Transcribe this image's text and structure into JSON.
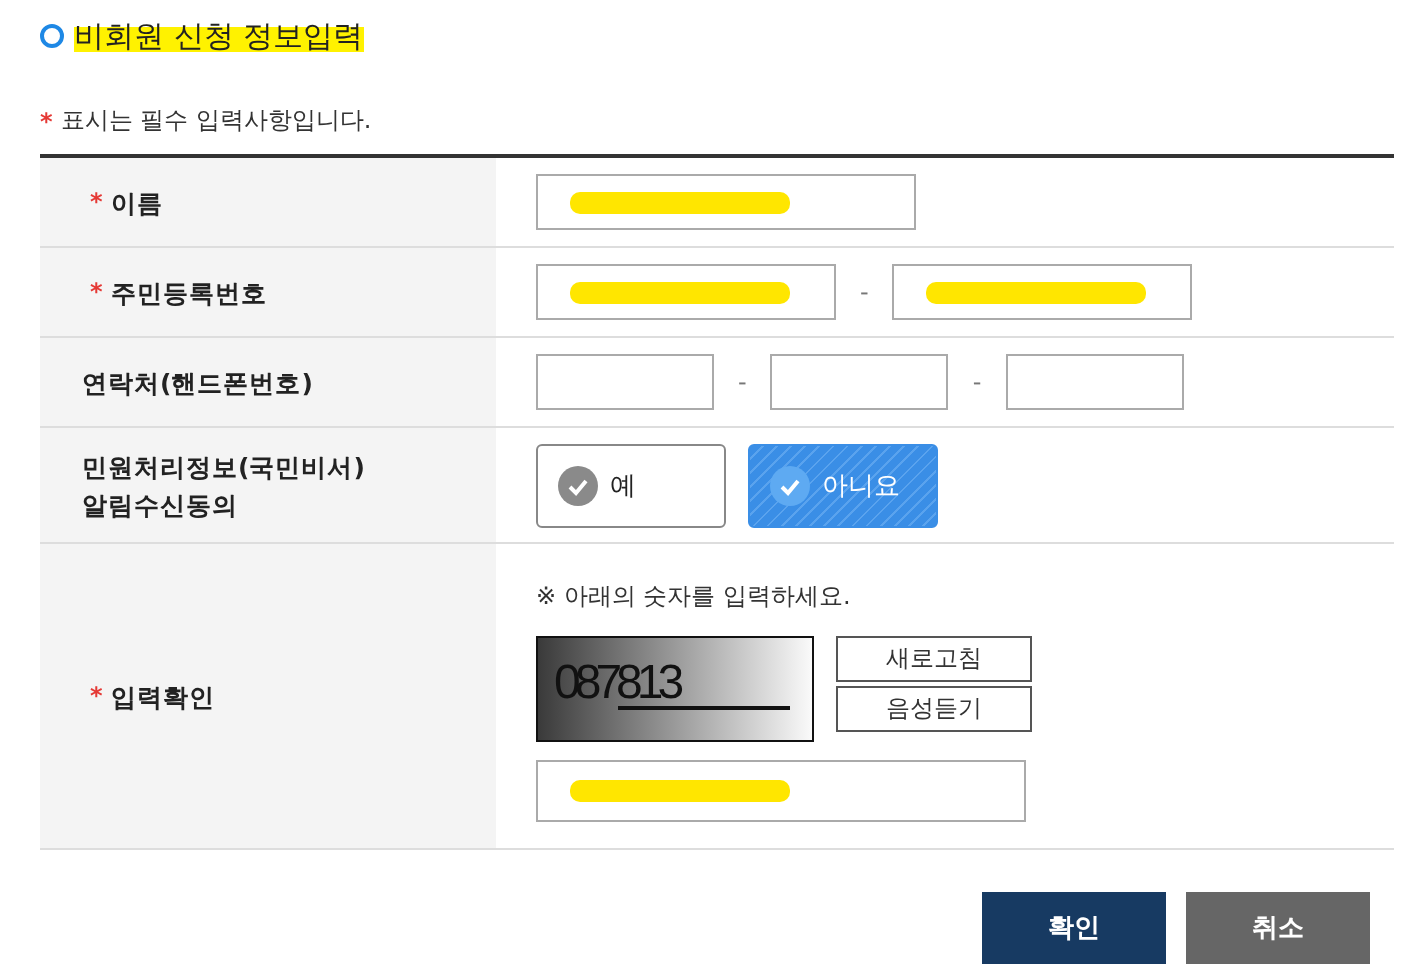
{
  "title": {
    "text": "비회원 신청 정보입력",
    "highlighted": true
  },
  "note": {
    "mark": "*",
    "text": "표시는 필수 입력사항입니다."
  },
  "rows": [
    {
      "kind": "text",
      "label": "이름",
      "required": true,
      "fields": [
        {
          "redacted": true
        }
      ]
    },
    {
      "kind": "split",
      "label": "주민등록번호",
      "required": true,
      "separator": "-",
      "fields": [
        {
          "redacted": true
        },
        {
          "redacted": true
        }
      ]
    },
    {
      "kind": "split",
      "label": "연락처(핸드폰번호)",
      "required": false,
      "separator": "-",
      "fields": [
        {
          "redacted": false
        },
        {
          "redacted": false
        },
        {
          "redacted": false
        }
      ]
    },
    {
      "kind": "choice",
      "label": "민원처리정보(국민비서)\n알림수신동의",
      "required": false,
      "options": [
        {
          "label": "예",
          "selected": false
        },
        {
          "label": "아니요",
          "selected": true
        }
      ]
    },
    {
      "kind": "captcha",
      "label": "입력확인",
      "required": true,
      "instruction": "※ 아래의 숫자를 입력하세요.",
      "captcha": "087813",
      "buttons": [
        "새로고침",
        "음성듣기"
      ],
      "fields": [
        {
          "redacted": true
        }
      ]
    }
  ],
  "buttons": [
    {
      "label": "확인",
      "kind": "primary"
    },
    {
      "label": "취소",
      "kind": "secondary"
    }
  ]
}
